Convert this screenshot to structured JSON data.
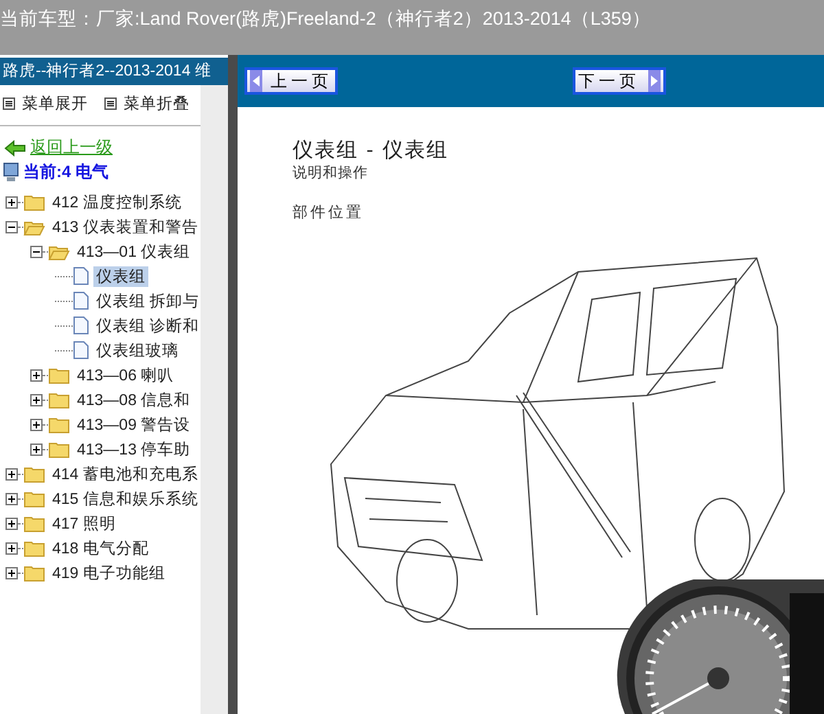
{
  "title_bar": {
    "title": "当前车型：厂家:Land Rover(路虎)Freeland-2（神行者2）2013-2014（L359）"
  },
  "sidebar": {
    "header": "路虎--神行者2--2013-2014 维",
    "menu": [
      {
        "label": "菜单展开"
      },
      {
        "label": "菜单折叠"
      }
    ],
    "back_link": "返回上一级",
    "current": "当前:4 电气",
    "tree": [
      {
        "kind": "folder",
        "label": "412 温度控制系统",
        "expanded": false
      },
      {
        "kind": "folder",
        "label": "413 仪表装置和警告",
        "expanded": true,
        "children": [
          {
            "kind": "folder",
            "label": "413—01 仪表组",
            "expanded": true,
            "children": [
              {
                "kind": "page",
                "label": "仪表组",
                "selected": true
              },
              {
                "kind": "page",
                "label": "仪表组 拆卸与",
                "selected": false
              },
              {
                "kind": "page",
                "label": "仪表组 诊断和",
                "selected": false
              },
              {
                "kind": "page",
                "label": "仪表组玻璃",
                "selected": false
              }
            ]
          },
          {
            "kind": "folder",
            "label": "413—06 喇叭",
            "expanded": false
          },
          {
            "kind": "folder",
            "label": "413—08 信息和",
            "expanded": false
          },
          {
            "kind": "folder",
            "label": "413—09 警告设",
            "expanded": false
          },
          {
            "kind": "folder",
            "label": "413—13 停车助",
            "expanded": false
          }
        ]
      },
      {
        "kind": "folder",
        "label": "414 蓄电池和充电系",
        "expanded": false
      },
      {
        "kind": "folder",
        "label": "415 信息和娱乐系统",
        "expanded": false
      },
      {
        "kind": "folder",
        "label": "417 照明",
        "expanded": false
      },
      {
        "kind": "folder",
        "label": "418 电气分配",
        "expanded": false
      },
      {
        "kind": "folder",
        "label": "419 电子功能组",
        "expanded": false
      }
    ]
  },
  "pager": {
    "prev": "上一页",
    "next": "下一页"
  },
  "document": {
    "title": "仪表组 - 仪表组",
    "subtitle": "说明和操作",
    "section": "部件位置"
  }
}
